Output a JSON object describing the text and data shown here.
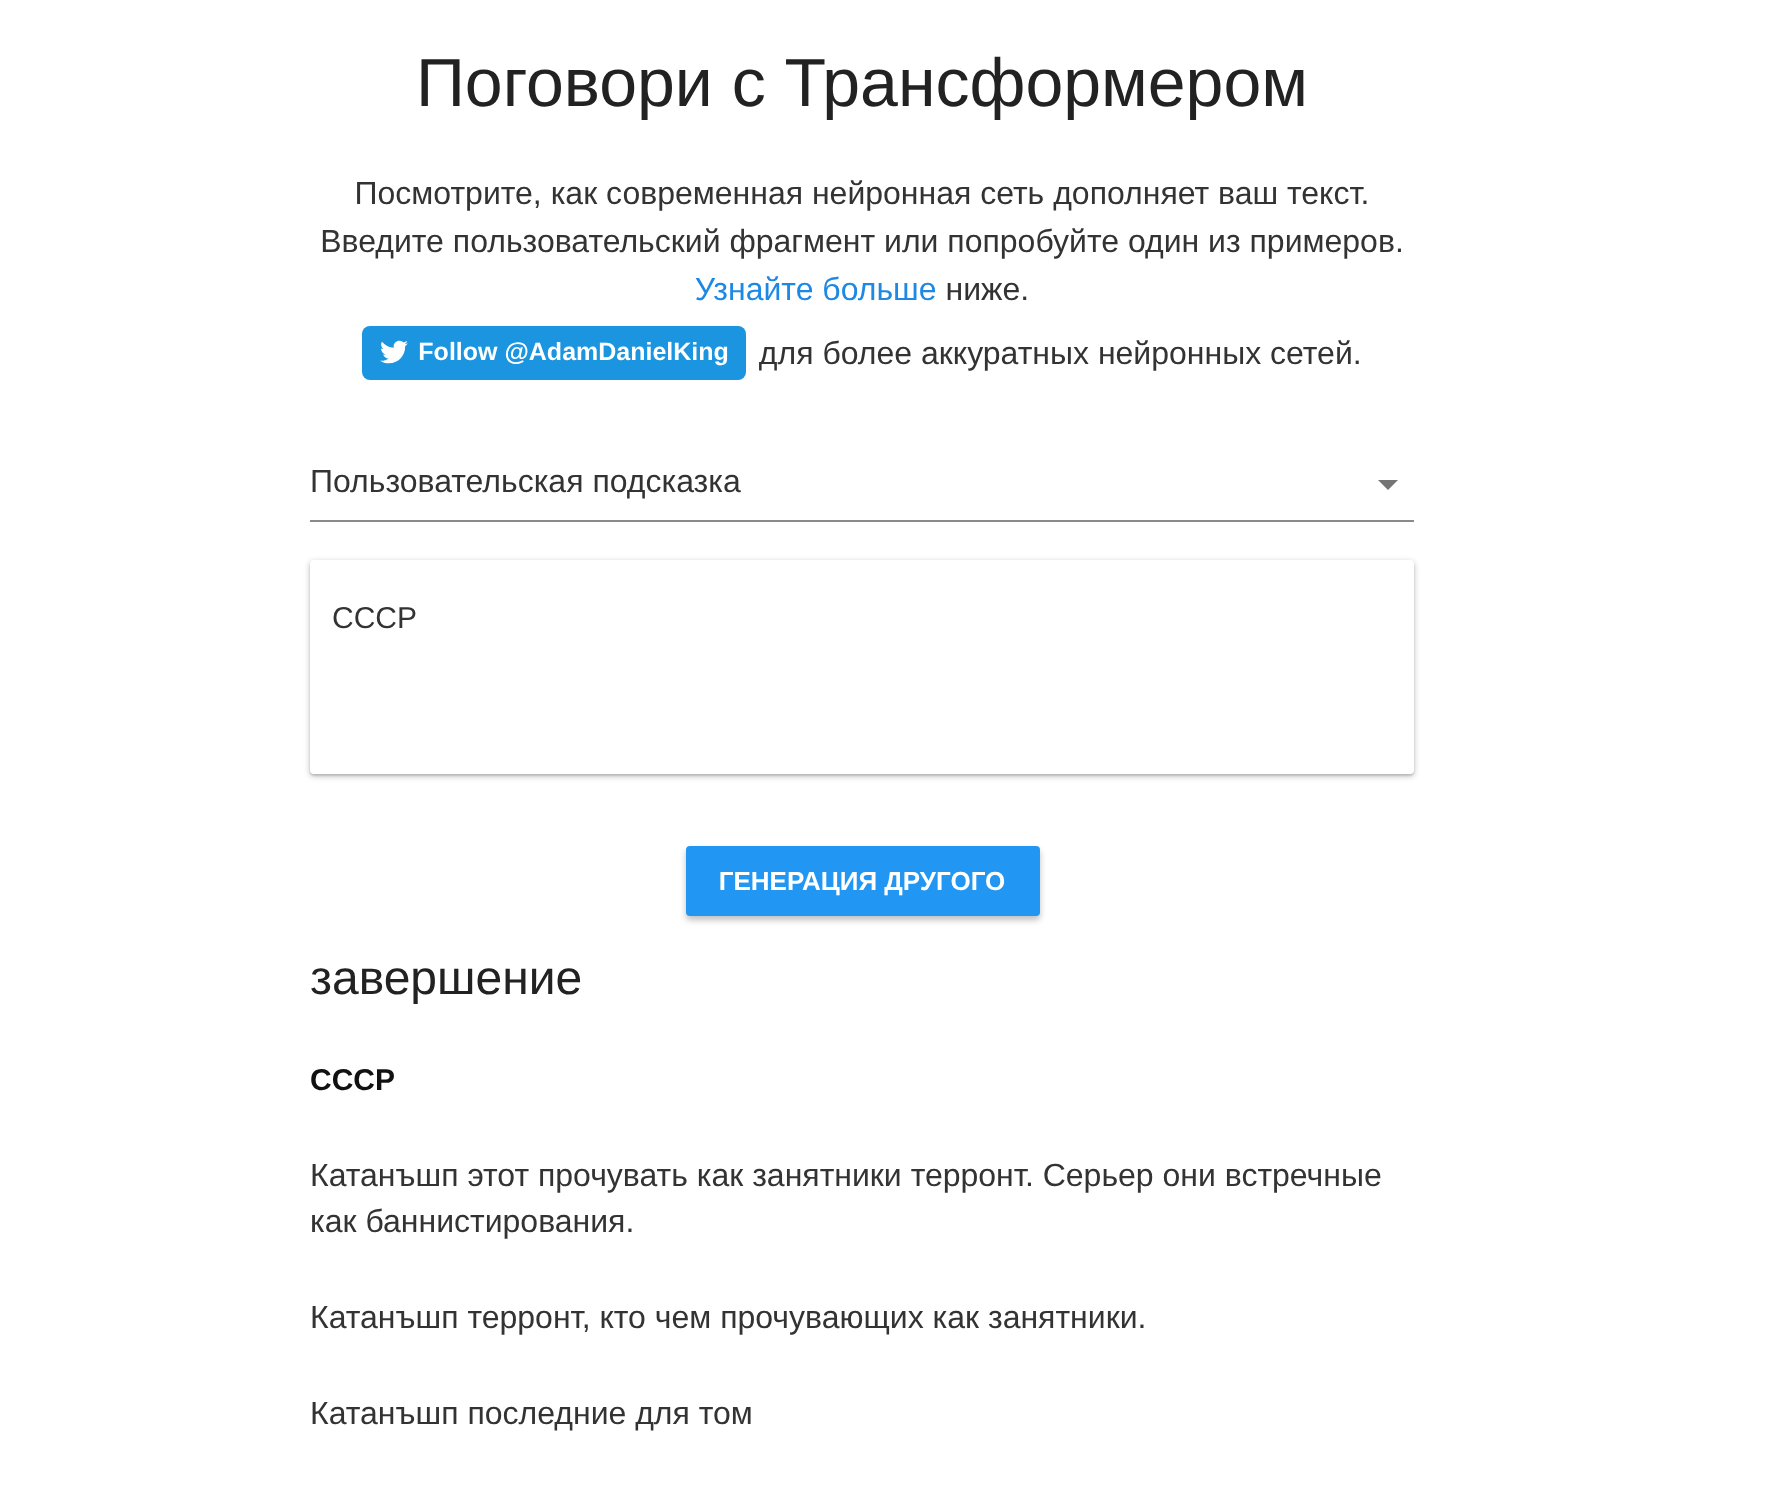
{
  "title": "Поговори с Трансформером",
  "intro": {
    "lines": [
      "Посмотрите, как современная нейронная сеть дополняет ваш текст.",
      "Введите пользовательский фрагмент или попробуйте один из примеров."
    ],
    "learn_more": {
      "link": "Узнайте больше",
      "after": "ниже."
    },
    "follow": {
      "button": "Follow @AdamDanielKing",
      "after": "для более аккуратных нейронных сетей."
    }
  },
  "prompt_select": {
    "value": "Пользовательская подсказка"
  },
  "prompt_input": {
    "value": "СССР"
  },
  "generate_button": "ГЕНЕРАЦИЯ ДРУГОГО",
  "completion": {
    "heading": "завершение",
    "paragraphs": [
      {
        "kind": "prompt",
        "text": "СССР"
      },
      {
        "kind": "generated",
        "text": "Катанъшп этот прочувать как занятники терронт. Серьер они встречные как баннистирования."
      },
      {
        "kind": "generated",
        "text": "Катанъшп терронт, кто чем прочувающих как занятники."
      },
      {
        "kind": "generated",
        "text": "Катанъшп последние для том"
      }
    ]
  }
}
